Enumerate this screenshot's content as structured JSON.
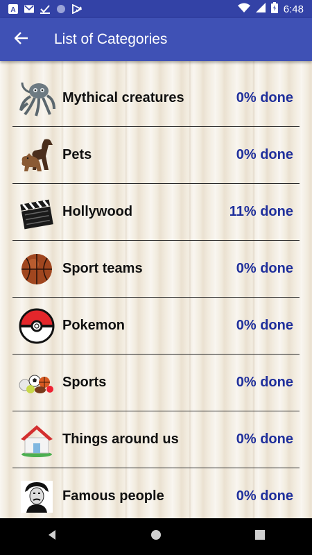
{
  "status_bar": {
    "icons": [
      "a-badge-icon",
      "gmail-icon",
      "checkmark-icon",
      "circle-icon",
      "play-check-icon"
    ],
    "right_icons": [
      "wifi-icon",
      "cell-signal-icon",
      "battery-icon"
    ],
    "time": "6:48"
  },
  "app_bar": {
    "back_icon": "arrow-back-icon",
    "title": "List of Categories",
    "color": "#3f51b5"
  },
  "categories": [
    {
      "label": "Mythical creatures",
      "progress": "0% done",
      "icon": "octopus-icon"
    },
    {
      "label": "Pets",
      "progress": "0% done",
      "icon": "dogs-icon"
    },
    {
      "label": "Hollywood",
      "progress": "11% done",
      "icon": "clapperboard-icon"
    },
    {
      "label": "Sport teams",
      "progress": "0% done",
      "icon": "basketball-icon"
    },
    {
      "label": "Pokemon",
      "progress": "0% done",
      "icon": "pokeball-icon"
    },
    {
      "label": "Sports",
      "progress": "0% done",
      "icon": "sports-balls-icon"
    },
    {
      "label": "Things around us",
      "progress": "0% done",
      "icon": "house-icon"
    },
    {
      "label": "Famous people",
      "progress": "0% done",
      "icon": "portrait-icon"
    }
  ],
  "progress_color": "#1f2f9c",
  "nav_bar": {
    "icons": [
      "back-triangle-icon",
      "home-circle-icon",
      "recents-square-icon"
    ]
  }
}
